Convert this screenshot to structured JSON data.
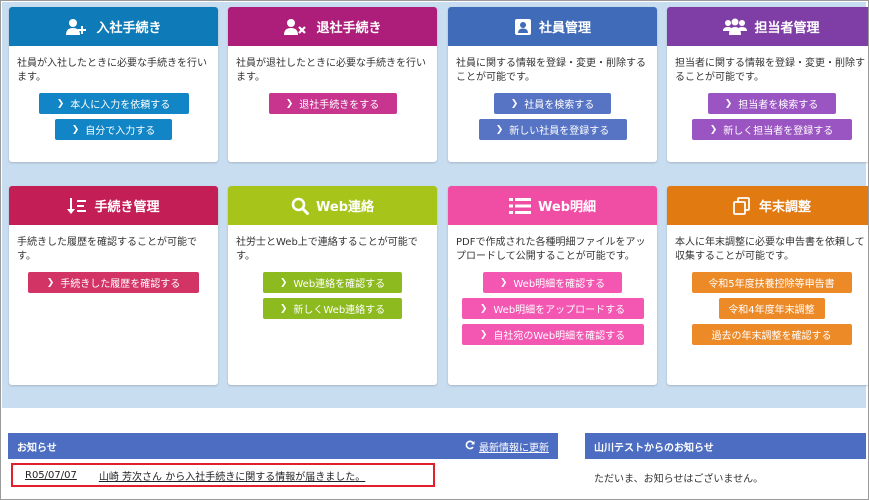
{
  "cards": [
    {
      "title": "入社手続き",
      "desc": "社員が入社したときに必要な手続きを行います。",
      "buttons": [
        "本人に入力を依頼する",
        "自分で入力する"
      ]
    },
    {
      "title": "退社手続き",
      "desc": "社員が退社したときに必要な手続きを行います。",
      "buttons": [
        "退社手続きをする"
      ]
    },
    {
      "title": "社員管理",
      "desc": "社員に関する情報を登録・変更・削除することが可能です。",
      "buttons": [
        "社員を検索する",
        "新しい社員を登録する"
      ]
    },
    {
      "title": "担当者管理",
      "desc": "担当者に関する情報を登録・変更・削除することが可能です。",
      "buttons": [
        "担当者を検索する",
        "新しく担当者を登録する"
      ]
    },
    {
      "title": "手続き管理",
      "desc": "手続きした履歴を確認することが可能です。",
      "buttons": [
        "手続きした履歴を確認する"
      ]
    },
    {
      "title": "Web連絡",
      "desc": "社労士とWeb上で連絡することが可能です。",
      "buttons": [
        "Web連絡を確認する",
        "新しくWeb連絡する"
      ]
    },
    {
      "title": "Web明細",
      "desc": "PDFで作成された各種明細ファイルをアップロードして公開することが可能です。",
      "buttons": [
        "Web明細を確認する",
        "Web明細をアップロードする",
        "自社宛のWeb明細を確認する"
      ]
    },
    {
      "title": "年末調整",
      "desc": "本人に年末調整に必要な申告書を依頼して収集することが可能です。",
      "buttons": [
        "令和5年度扶養控除等申告書",
        "令和4年度年末調整",
        "過去の年末調整を確認する"
      ]
    }
  ],
  "colors": {
    "card_headers": [
      "#0e7bb8",
      "#ad1e7a",
      "#3f6bb8",
      "#7f3ea5",
      "#c41e57",
      "#a7c41a",
      "#f04da5",
      "#e27a12"
    ],
    "buttons": [
      "#1185c6",
      "#c8358f",
      "#5774c4",
      "#9a55c2",
      "#d23565",
      "#8dba1e",
      "#f357b2",
      "#ed8a28"
    ],
    "notice_header": "#4c6dc2",
    "highlight": "#e0202a",
    "page_bg": "#c9ddf1"
  },
  "notices": {
    "title": "お知らせ",
    "refresh_label": "最新情報に更新",
    "items": [
      {
        "date": "R05/07/07",
        "text": "山崎 芳次さん から入社手続きに関する情報が届きました。"
      }
    ]
  },
  "office_notices": {
    "title": "山川テストからのお知らせ",
    "empty_text": "ただいま、お知らせはございません。"
  }
}
